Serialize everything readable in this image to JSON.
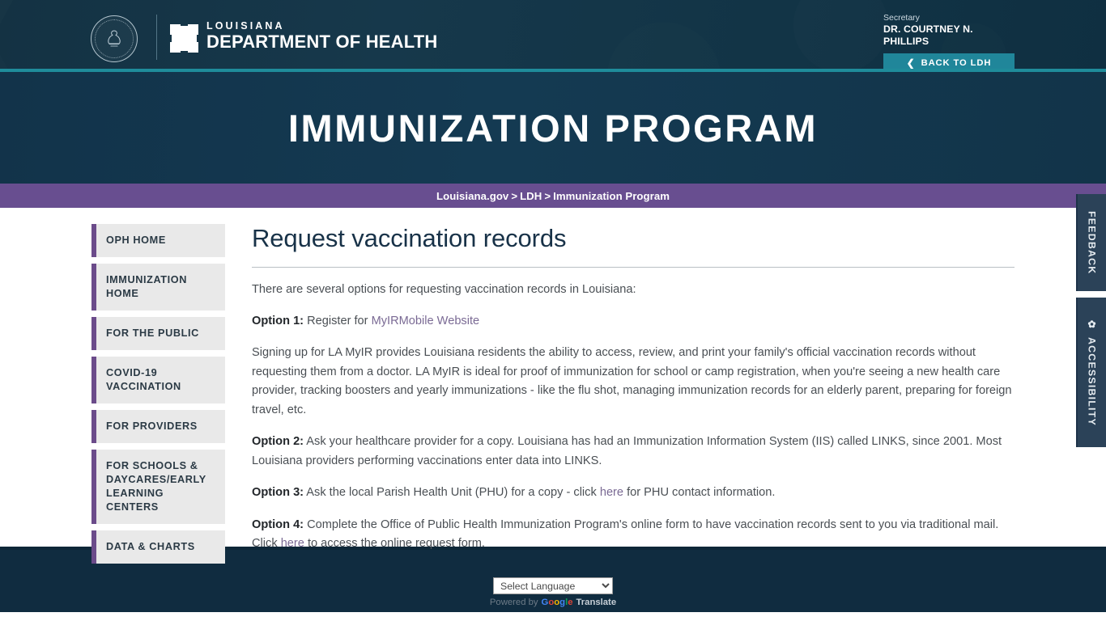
{
  "header": {
    "seal_alt": "louisiana-state-seal",
    "brand_line1": "LOUISIANA",
    "brand_line2": "DEPARTMENT OF HEALTH",
    "secretary_label": "Secretary",
    "secretary_name": "DR. COURTNEY N. PHILLIPS",
    "back_button": "BACK TO LDH",
    "accent_teal": "#1f8c9b",
    "button_teal": "#20869a"
  },
  "hero": {
    "title": "IMMUNIZATION PROGRAM",
    "bg": "#13344d"
  },
  "breadcrumb": {
    "bg": "#684e90",
    "items": [
      {
        "label": "Louisiana.gov"
      },
      {
        "label": "LDH"
      },
      {
        "label": "Immunization Program"
      }
    ],
    "separator": ">"
  },
  "sidebar": {
    "accent": "#6b4b8a",
    "items": [
      {
        "label": "OPH HOME"
      },
      {
        "label": "IMMUNIZATION HOME"
      },
      {
        "label": "FOR THE PUBLIC"
      },
      {
        "label": "COVID-19 VACCINATION"
      },
      {
        "label": "FOR PROVIDERS"
      },
      {
        "label": "FOR SCHOOLS & DAYCARES/EARLY LEARNING CENTERS"
      },
      {
        "label": "DATA & CHARTS"
      }
    ]
  },
  "main": {
    "page_title": "Request vaccination records",
    "intro": "There are several options for requesting vaccination records in Louisiana:",
    "option1_label": "Option 1:",
    "option1_text": " Register for ",
    "option1_link": "MyIRMobile Website",
    "paragraph_myir": "Signing up for LA MyIR provides Louisiana residents the ability to access, review, and print your family's official vaccination records without requesting them from a doctor. LA MyIR is ideal for proof of immunization for school or camp registration, when you're seeing a new health care provider, tracking boosters and yearly immunizations - like the flu shot, managing immunization records for an elderly parent, preparing for foreign travel, etc.",
    "option2_label": "Option 2:",
    "option2_text": " Ask your healthcare provider for a copy. Louisiana has had an Immunization Information System (IIS) called LINKS, since 2001. Most Louisiana providers performing vaccinations enter data into LINKS.",
    "option3_label": "Option 3:",
    "option3_text_a": " Ask the local Parish Health Unit (PHU) for a copy - click ",
    "option3_link": "here",
    "option3_text_b": " for PHU contact information.",
    "option4_label": "Option 4:",
    "option4_text_a": " Complete the Office of Public Health Immunization Program's online form to have vaccination records sent to you via traditional mail. Click ",
    "option4_link": "here",
    "option4_text_b": " to access the online request form.",
    "link_color": "#7a6a94"
  },
  "side_tabs": {
    "feedback": "FEEDBACK",
    "accessibility": "ACCESSIBILITY",
    "gear_glyph": "✿"
  },
  "footer": {
    "language_selected": "Select Language",
    "language_options": [
      "Select Language"
    ],
    "powered_by": "Powered by",
    "google": [
      "G",
      "o",
      "o",
      "g",
      "l",
      "e"
    ],
    "translate": "Translate",
    "bg": "#102c40"
  }
}
